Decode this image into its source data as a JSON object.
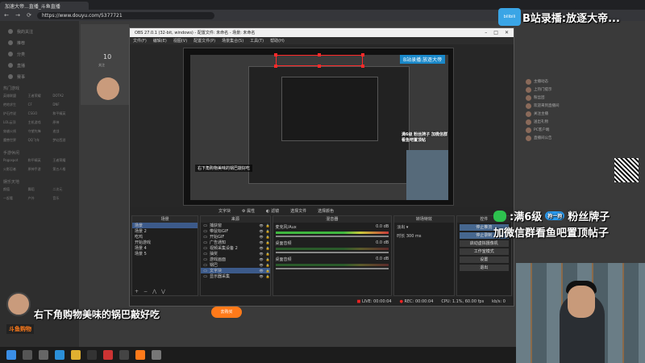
{
  "browser": {
    "tab_title": "加速大帝...直播_斗鱼直播",
    "url": "https://www.douyu.com/5377721"
  },
  "overlay": {
    "top_title": "B站录播:放逐大帝...",
    "tv_label": "bilibili",
    "promo_line1": ":满6级",
    "promo_badge": "抱一抱",
    "promo_line1_tail": "粉丝牌子",
    "promo_line2": "加微信群看鱼吧置顶帖子",
    "bottom_text": "右下角购物美味的锅巴敲好吃",
    "buy_button": "去购买",
    "brand_logo": "斗鱼购物"
  },
  "douyu": {
    "brand": "斗鱼",
    "follow_count": "10",
    "follow_label": "关注",
    "nav_items": [
      "我的关注",
      "推荐",
      "分类",
      "直播",
      "赛事"
    ],
    "section_hot": "热门游戏",
    "hot_games": [
      "英雄联盟",
      "王者荣耀",
      "DOTA2",
      "绝地求生",
      "CF",
      "DNF",
      "炉石传说",
      "CSGO",
      "和平精英",
      "LOL云顶",
      "主机游戏",
      "原神",
      "穿越火线",
      "守望先锋",
      "逆战",
      "魔兽世界",
      "QQ飞车",
      "梦幻西游"
    ],
    "section_mobile": "手游休闲",
    "mobile_games": [
      "Pogospot",
      "和平精英",
      "王者荣耀",
      "火影忍者",
      "原神手游",
      "第五人格"
    ],
    "section_ent": "娱乐天地",
    "ent_items": [
      "颜值",
      "舞蹈",
      "二次元",
      "一起看",
      "户外",
      "音乐"
    ]
  },
  "obs": {
    "title": "OBS 27.0.1 (32-bit, windows) - 配置文件: 未命名 - 场景: 未命名",
    "menu": [
      "文件(F)",
      "编辑(E)",
      "视图(V)",
      "配置文件(P)",
      "场景集合(S)",
      "工具(T)",
      "帮助(H)"
    ],
    "toolbar": [
      "文字块",
      "属性",
      "滤镜",
      "选择文件",
      "选择颜色"
    ],
    "scenes_title": "场景",
    "scenes": [
      "场景",
      "场景 2",
      "吃鸡",
      "开始游戏",
      "场景 4",
      "场景 5"
    ],
    "sources_title": "来源",
    "sources": [
      "捕获窗",
      "带鼠标GIF",
      "开始GIF",
      "广告通知",
      "视频采集设备 2",
      "抽奖",
      "游戏画面",
      "锅巴",
      "文字块",
      "显示器采集"
    ],
    "mixer_title": "混音器",
    "mixer": [
      {
        "name": "麦克风/Aux",
        "db": "0.0 dB"
      },
      {
        "name": "桌面音频",
        "db": "0.0 dB"
      },
      {
        "name": "桌面音频",
        "db": "0.0 dB"
      }
    ],
    "transitions_title": "转场特效",
    "transition_type": "淡出",
    "duration_label": "时长",
    "duration": "300 ms",
    "controls_title": "控件",
    "controls": [
      "停止推流",
      "停止录制",
      "启动虚拟摄像机",
      "工作室模式",
      "设置",
      "退出"
    ],
    "inner_caption": "右下角购物美味的锅巴敲好吃",
    "inner_overlay": "满6级 粉丝牌子 加微信群看鱼吧置顶帖",
    "inner_bili": "B站录播:放逐大帝",
    "status": {
      "live": "LIVE: 00:00:04",
      "rec": "REC: 00:00:04",
      "cpu": "CPU: 1.1%, 60.00 fps",
      "kbps": "kb/s: 0"
    }
  },
  "chat": {
    "lines": [
      "主播动态",
      "上热门提示",
      "粉丝团",
      "欢迎来到直播间",
      "关注主播",
      "送出礼物",
      "PC客户端",
      "直播间公告"
    ]
  },
  "taskbar": {
    "icons": [
      "windows-start",
      "search",
      "task-view",
      "edge",
      "explorer",
      "steam",
      "netease",
      "obs",
      "douyu",
      "settings"
    ]
  }
}
